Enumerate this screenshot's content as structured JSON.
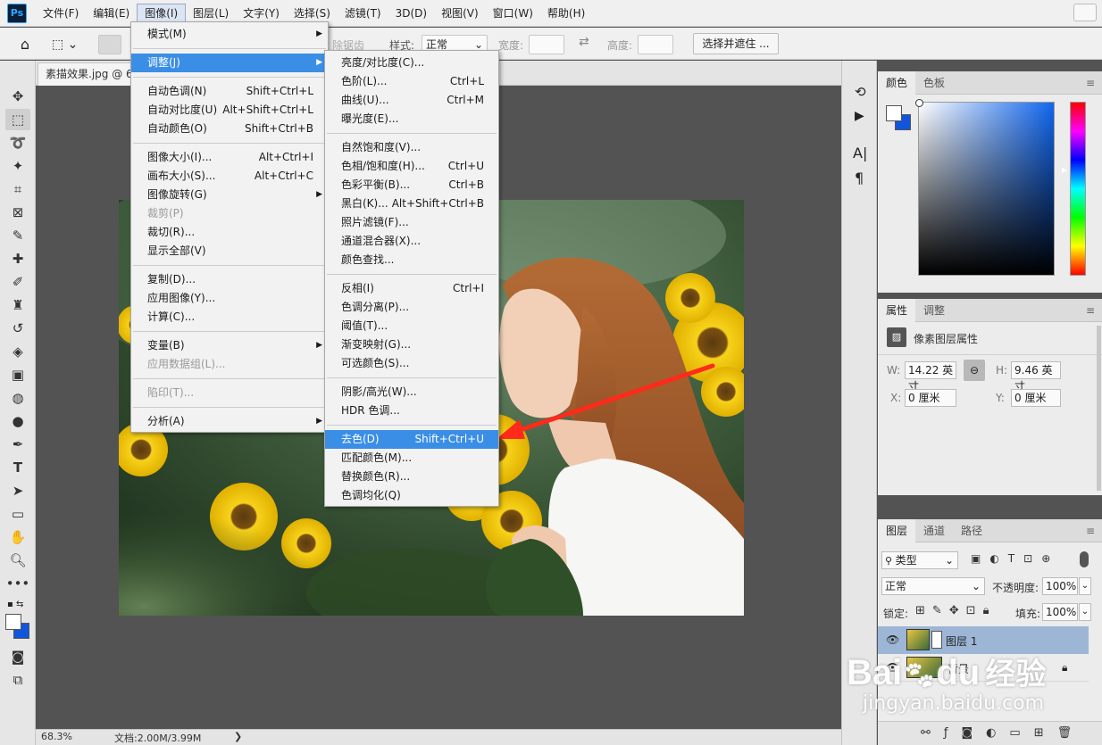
{
  "app": {
    "logo": "Ps"
  },
  "menubar": [
    "文件(F)",
    "编辑(E)",
    "图像(I)",
    "图层(L)",
    "文字(Y)",
    "选择(S)",
    "滤镜(T)",
    "3D(D)",
    "视图(V)",
    "窗口(W)",
    "帮助(H)"
  ],
  "options": {
    "feather_partial": "除锯齿",
    "style_label": "样式:",
    "style_value": "正常",
    "width_label": "宽度:",
    "height_label": "高度:",
    "select_mask": "选择并遮住 ..."
  },
  "document_tab": "素描效果.jpg @ 6",
  "image_menu": [
    {
      "label": "模式(M)",
      "submenu": true
    },
    {
      "sep": true
    },
    {
      "label": "调整(J)",
      "submenu": true,
      "highlight": true
    },
    {
      "sep": true
    },
    {
      "label": "自动色调(N)",
      "shortcut": "Shift+Ctrl+L"
    },
    {
      "label": "自动对比度(U)",
      "shortcut": "Alt+Shift+Ctrl+L"
    },
    {
      "label": "自动颜色(O)",
      "shortcut": "Shift+Ctrl+B"
    },
    {
      "sep": true
    },
    {
      "label": "图像大小(I)...",
      "shortcut": "Alt+Ctrl+I"
    },
    {
      "label": "画布大小(S)...",
      "shortcut": "Alt+Ctrl+C"
    },
    {
      "label": "图像旋转(G)",
      "submenu": true
    },
    {
      "label": "裁剪(P)",
      "disabled": true
    },
    {
      "label": "裁切(R)..."
    },
    {
      "label": "显示全部(V)"
    },
    {
      "sep": true
    },
    {
      "label": "复制(D)..."
    },
    {
      "label": "应用图像(Y)..."
    },
    {
      "label": "计算(C)..."
    },
    {
      "sep": true
    },
    {
      "label": "变量(B)",
      "submenu": true
    },
    {
      "label": "应用数据组(L)...",
      "disabled": true
    },
    {
      "sep": true
    },
    {
      "label": "陷印(T)...",
      "disabled": true
    },
    {
      "sep": true
    },
    {
      "label": "分析(A)",
      "submenu": true
    }
  ],
  "adjust_menu": [
    {
      "label": "亮度/对比度(C)..."
    },
    {
      "label": "色阶(L)...",
      "shortcut": "Ctrl+L"
    },
    {
      "label": "曲线(U)...",
      "shortcut": "Ctrl+M"
    },
    {
      "label": "曝光度(E)..."
    },
    {
      "sep": true
    },
    {
      "label": "自然饱和度(V)..."
    },
    {
      "label": "色相/饱和度(H)...",
      "shortcut": "Ctrl+U"
    },
    {
      "label": "色彩平衡(B)...",
      "shortcut": "Ctrl+B"
    },
    {
      "label": "黑白(K)...",
      "shortcut": "Alt+Shift+Ctrl+B"
    },
    {
      "label": "照片滤镜(F)..."
    },
    {
      "label": "通道混合器(X)..."
    },
    {
      "label": "颜色查找..."
    },
    {
      "sep": true
    },
    {
      "label": "反相(I)",
      "shortcut": "Ctrl+I"
    },
    {
      "label": "色调分离(P)..."
    },
    {
      "label": "阈值(T)..."
    },
    {
      "label": "渐变映射(G)..."
    },
    {
      "label": "可选颜色(S)..."
    },
    {
      "sep": true
    },
    {
      "label": "阴影/高光(W)..."
    },
    {
      "label": "HDR 色调..."
    },
    {
      "sep": true
    },
    {
      "label": "去色(D)",
      "shortcut": "Shift+Ctrl+U",
      "highlight": true
    },
    {
      "label": "匹配颜色(M)..."
    },
    {
      "label": "替换颜色(R)..."
    },
    {
      "label": "色调均化(Q)"
    }
  ],
  "status": {
    "zoom": "68.3%",
    "doc": "文档:2.00M/3.99M",
    "arrow": "❯"
  },
  "color_panel": {
    "tabs": [
      "颜色",
      "色板"
    ],
    "fg": "#ffffff",
    "bg": "#1155dd"
  },
  "properties_panel": {
    "tabs": [
      "属性",
      "调整"
    ],
    "title": "像素图层属性",
    "w_label": "W:",
    "w_value": "14.22 英寸",
    "h_label": "H:",
    "h_value": "9.46 英寸",
    "x_label": "X:",
    "x_value": "0 厘米",
    "y_label": "Y:",
    "y_value": "0 厘米"
  },
  "layers_panel": {
    "tabs": [
      "图层",
      "通道",
      "路径"
    ],
    "filter": "类型",
    "blend": "正常",
    "opacity_label": "不透明度:",
    "opacity": "100%",
    "lock_label": "锁定:",
    "fill_label": "填充:",
    "fill": "100%",
    "layers": [
      {
        "name": "图层 1",
        "selected": true
      },
      {
        "name": "背景",
        "locked": true
      }
    ]
  },
  "watermark": {
    "brand": "Bai",
    "brand2": "du",
    "cn": "经验",
    "url": "jingyan.baidu.com"
  }
}
